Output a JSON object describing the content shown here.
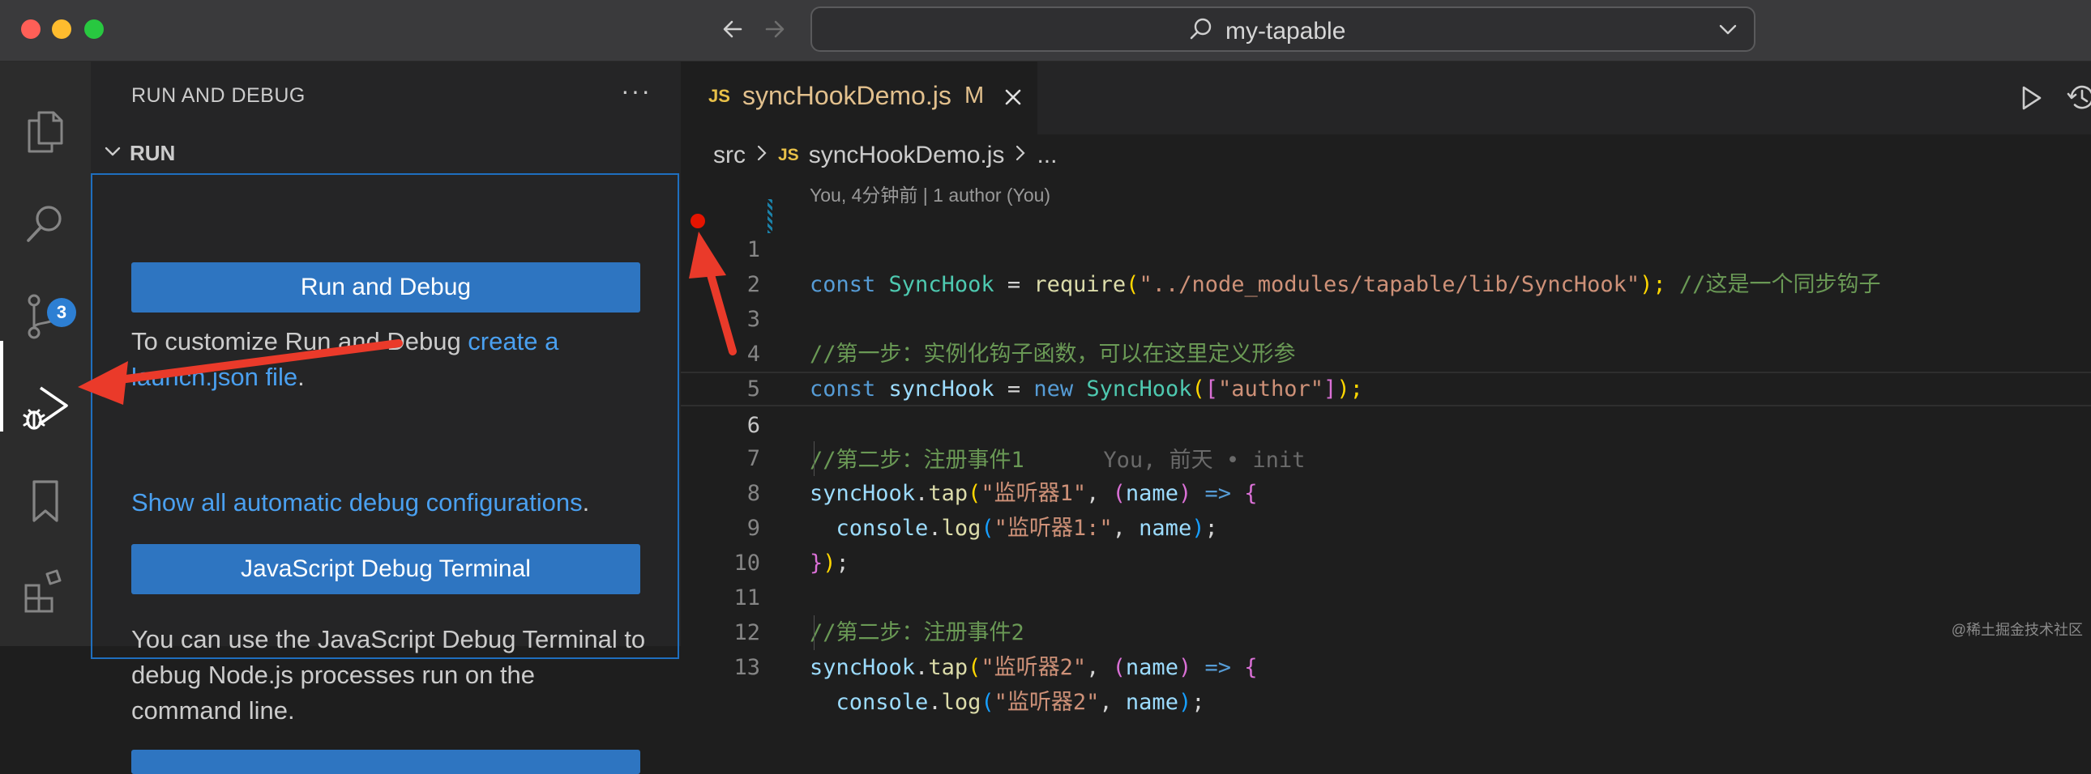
{
  "window": {
    "command_center_text": "my-tapable"
  },
  "activity_bar": {
    "scm_badge": "3"
  },
  "sidebar": {
    "title": "RUN AND DEBUG",
    "more_label": "···",
    "section_label": "RUN",
    "run_debug_button": "Run and Debug",
    "customize_text": "To customize Run and Debug ",
    "create_link": "create a launch.json file",
    "period": ".",
    "show_all_link": "Show all automatic debug configurations",
    "js_terminal_button": "JavaScript Debug Terminal",
    "terminal_desc": "You can use the JavaScript Debug Terminal to debug Node.js processes run on the command line."
  },
  "editor": {
    "tab": {
      "js_badge": "JS",
      "filename": "syncHookDemo.js",
      "status": "M"
    },
    "breadcrumbs": [
      "src",
      "syncHookDemo.js",
      "..."
    ],
    "codelens": "You, 4分钟前 | 1 author (You)",
    "line_numbers": [
      "1",
      "2",
      "3",
      "4",
      "5",
      "6",
      "7",
      "8",
      "9",
      "10",
      "11",
      "12",
      "13"
    ],
    "code": {
      "l1": {
        "const": "const",
        "SyncHook": "SyncHook",
        "eq": " = ",
        "require": "require",
        "open": "(",
        "path": "\"../node_modules/tapable/lib/SyncHook\"",
        "close": ");",
        "comment": " //这是一个同步钩子"
      },
      "l3": {
        "comment": "//第一步：实例化钩子函数，可以在这里定义形参"
      },
      "l4": {
        "const": "const",
        "var": "syncHook",
        "eq": " = ",
        "new": "new",
        "cls": "SyncHook",
        "open": "(",
        "bracket_open": "[",
        "str": "\"author\"",
        "bracket_close": "]",
        "close": ");"
      },
      "l6": {
        "comment": "//第二步：注册事件1",
        "blame": "You, 前天 • init"
      },
      "l7": {
        "obj": "syncHook",
        "dot": ".",
        "fn": "tap",
        "open": "(",
        "str": "\"监听器1\"",
        "comma": ", ",
        "popen": "(",
        "param": "name",
        "pclose": ")",
        "arrow": " => ",
        "brace": "{"
      },
      "l8": {
        "obj": "console",
        "dot": ".",
        "fn": "log",
        "open": "(",
        "str": "\"监听器1:\"",
        "comma": ", ",
        "param": "name",
        "close": ")",
        "semi": ";"
      },
      "l9": {
        "brace": "}",
        "paren": ")",
        "semi": ";"
      },
      "l11": {
        "comment": "//第二步：注册事件2"
      },
      "l12": {
        "obj": "syncHook",
        "dot": ".",
        "fn": "tap",
        "open": "(",
        "str": "\"监听器2\"",
        "comma": ", ",
        "popen": "(",
        "param": "name",
        "pclose": ")",
        "arrow": " => ",
        "brace": "{"
      },
      "l13": {
        "obj": "console",
        "dot": ".",
        "fn": "log",
        "open": "(",
        "str": "\"监听器2\"",
        "comma": ", ",
        "param": "name",
        "close": ")",
        "semi": ";"
      }
    }
  },
  "watermark": "@稀土掘金技术社区",
  "colors": {
    "accent": "#2e75c1",
    "breakpoint": "#e51400",
    "annotation_arrow": "#ea3a2a"
  }
}
